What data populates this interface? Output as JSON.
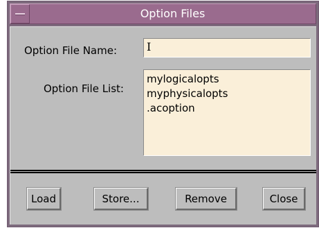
{
  "window": {
    "title": "Option Files",
    "menu_icon": "window-menu-icon"
  },
  "form": {
    "name_label": "Option File Name:",
    "name_value": "",
    "list_label": "Option File List:",
    "files": [
      "mylogicalopts",
      "myphysicalopts",
      ".acoption"
    ]
  },
  "buttons": {
    "load": "Load",
    "store": "Store...",
    "remove": "Remove",
    "close": "Close"
  },
  "colors": {
    "title_bar": "#9a6b8e",
    "dialog_bg": "#bdbdbd",
    "field_bg": "#faefd9"
  }
}
